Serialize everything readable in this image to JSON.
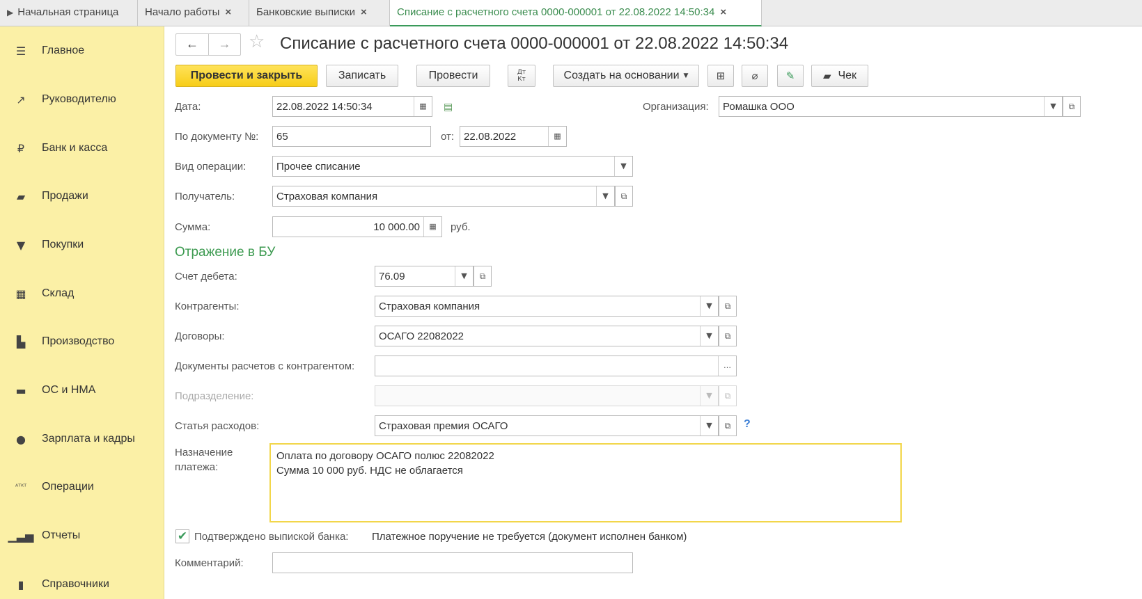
{
  "tabs": {
    "home": "Начальная страница",
    "start": "Начало работы",
    "statements": "Банковские выписки",
    "document": "Списание с расчетного счета 0000-000001 от 22.08.2022 14:50:34",
    "close_glyph": "×"
  },
  "sidebar": {
    "items": [
      {
        "label": "Главное",
        "icon": "menu-icon"
      },
      {
        "label": "Руководителю",
        "icon": "trend-icon"
      },
      {
        "label": "Банк и касса",
        "icon": "ruble-icon"
      },
      {
        "label": "Продажи",
        "icon": "bag-icon"
      },
      {
        "label": "Покупки",
        "icon": "cart-icon"
      },
      {
        "label": "Склад",
        "icon": "warehouse-icon"
      },
      {
        "label": "Производство",
        "icon": "factory-icon"
      },
      {
        "label": "ОС и НМА",
        "icon": "truck-icon"
      },
      {
        "label": "Зарплата и кадры",
        "icon": "person-icon"
      },
      {
        "label": "Операции",
        "icon": "dt-kt-icon"
      },
      {
        "label": "Отчеты",
        "icon": "bar-chart-icon"
      },
      {
        "label": "Справочники",
        "icon": "book-icon"
      }
    ]
  },
  "header": {
    "title": "Списание с расчетного счета 0000-000001 от 22.08.2022 14:50:34"
  },
  "toolbar": {
    "post_close": "Провести и закрыть",
    "save": "Записать",
    "post": "Провести",
    "dtkt": "ДТКТ",
    "create_based": "Создать на основании",
    "receipt": "Чек"
  },
  "form": {
    "date_label": "Дата:",
    "date_value": "22.08.2022 14:50:34",
    "org_label": "Организация:",
    "org_value": "Ромашка ООО",
    "docnum_label": "По документу №:",
    "docnum_value": "65",
    "from_label": "от:",
    "from_value": "22.08.2022",
    "optype_label": "Вид операции:",
    "optype_value": "Прочее списание",
    "recipient_label": "Получатель:",
    "recipient_value": "Страховая компания",
    "amount_label": "Сумма:",
    "amount_value": "10 000.00",
    "currency": "руб."
  },
  "bu": {
    "section_title": "Отражение в БУ",
    "debit_label": "Счет дебета:",
    "debit_value": "76.09",
    "counterparty_label": "Контрагенты:",
    "counterparty_value": "Страховая компания",
    "contract_label": "Договоры:",
    "contract_value": "ОСАГО 22082022",
    "settlement_label": "Документы расчетов с контрагентом:",
    "settlement_value": "",
    "department_label": "Подразделение:",
    "department_value": "",
    "expense_label": "Статья расходов:",
    "expense_value": "Страховая премия ОСАГО",
    "help": "?"
  },
  "purpose": {
    "label_line1": "Назначение",
    "label_line2": "платежа:",
    "line1": "Оплата по договору ОСАГО полюс 22082022",
    "line2": "Сумма 10 000 руб. НДС не облагается"
  },
  "confirm": {
    "checked": true,
    "label": "Подтверждено выпиской банка:",
    "note": "Платежное поручение не требуется (документ исполнен банком)"
  },
  "comment": {
    "label": "Комментарий:",
    "value": ""
  }
}
